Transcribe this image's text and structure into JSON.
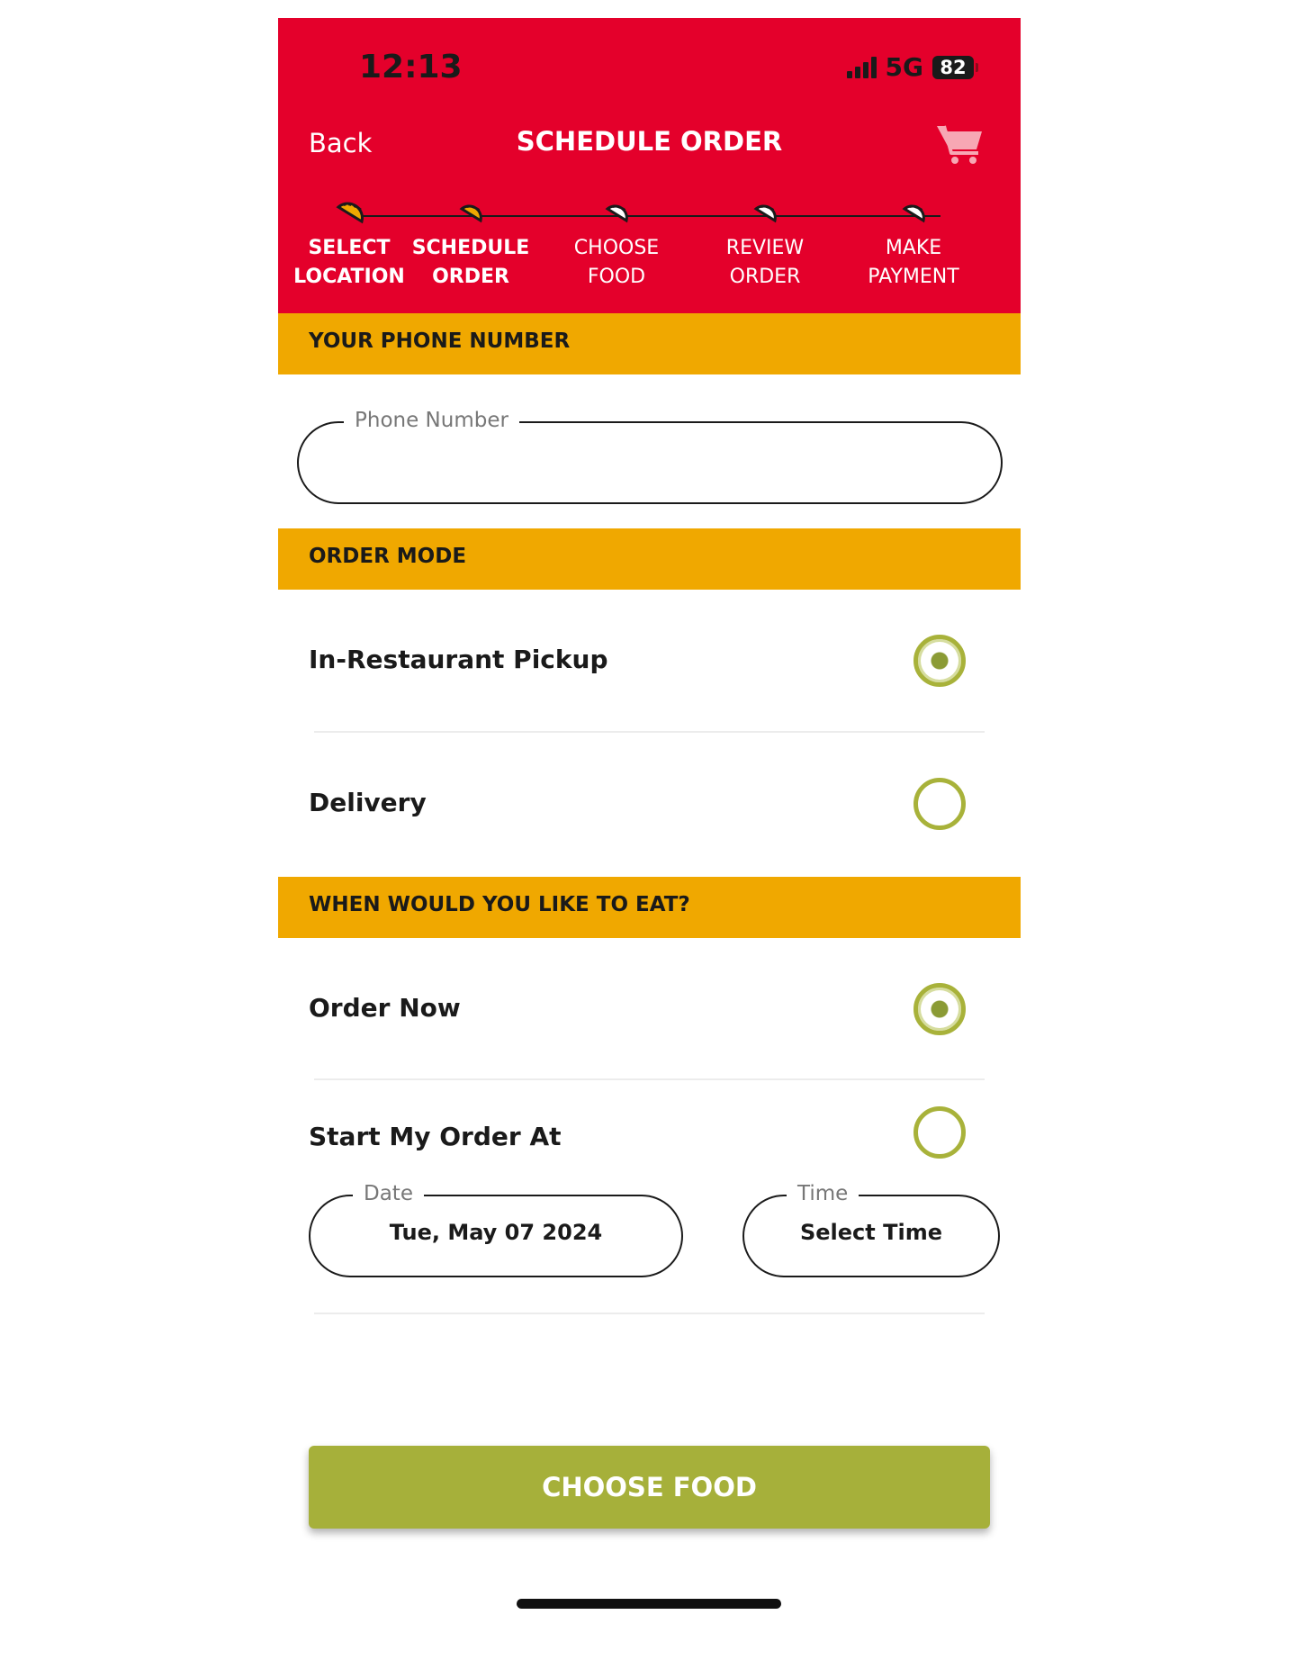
{
  "status_bar": {
    "time": "12:13",
    "network": "5G",
    "battery": "82"
  },
  "nav": {
    "back_label": "Back",
    "title": "SCHEDULE ORDER",
    "cart_icon": "cart-icon"
  },
  "steps": [
    {
      "line1": "SELECT",
      "line2": "LOCATION",
      "state": "done"
    },
    {
      "line1": "SCHEDULE",
      "line2": "ORDER",
      "state": "current"
    },
    {
      "line1": "CHOOSE",
      "line2": "FOOD",
      "state": "pending"
    },
    {
      "line1": "REVIEW",
      "line2": "ORDER",
      "state": "pending"
    },
    {
      "line1": "MAKE",
      "line2": "PAYMENT",
      "state": "pending"
    }
  ],
  "phone_section": {
    "header": "YOUR PHONE NUMBER",
    "field_label": "Phone Number",
    "field_value": ""
  },
  "order_mode": {
    "header": "ORDER MODE",
    "options": [
      {
        "label": "In-Restaurant Pickup",
        "selected": true
      },
      {
        "label": "Delivery",
        "selected": false
      }
    ]
  },
  "eat_time": {
    "header": "WHEN WOULD YOU LIKE TO EAT?",
    "options": [
      {
        "label": "Order Now",
        "selected": true
      },
      {
        "label": "Start My Order At",
        "selected": false
      }
    ],
    "date_label": "Date",
    "date_value": "Tue, May 07 2024",
    "time_label": "Time",
    "time_value": "Select Time"
  },
  "cta": {
    "label": "CHOOSE FOOD"
  },
  "colors": {
    "header_red": "#e4002b",
    "section_yellow": "#f0a800",
    "accent_green": "#a6b03a",
    "radio_green": "#a8b23a"
  }
}
